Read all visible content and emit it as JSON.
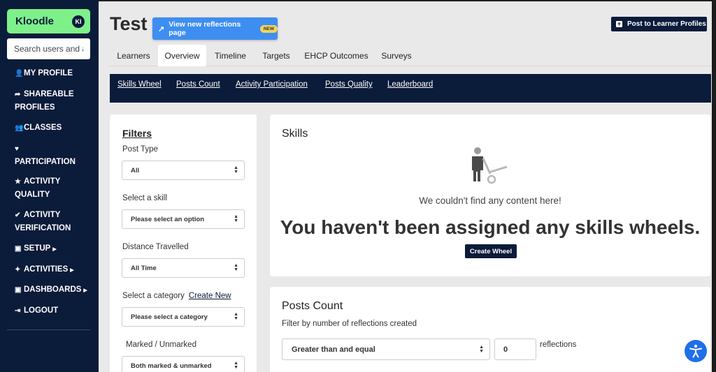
{
  "sidebar": {
    "brand": "Kloodle",
    "brand_badge": "KI",
    "search_placeholder": "Search users and a",
    "items": [
      {
        "label": "MY PROFILE",
        "icon": "user-icon",
        "glyph": "👤"
      },
      {
        "label": "SHAREABLE PROFILES",
        "icon": "share-icon",
        "glyph": "➦"
      },
      {
        "label": "CLASSES",
        "icon": "users-icon",
        "glyph": "👥"
      },
      {
        "label": "PARTICIPATION",
        "icon": "heart-icon",
        "glyph": "♥"
      },
      {
        "label": "ACTIVITY QUALITY",
        "icon": "star-icon",
        "glyph": "★"
      },
      {
        "label": "ACTIVITY VERIFICATION",
        "icon": "check-circle-icon",
        "glyph": "✔"
      },
      {
        "label": "SETUP",
        "icon": "setup-icon",
        "glyph": "▣"
      },
      {
        "label": "ACTIVITIES",
        "icon": "activities-icon",
        "glyph": "✦"
      },
      {
        "label": "DASHBOARDS",
        "icon": "dashboard-icon",
        "glyph": "▣"
      },
      {
        "label": "LOGOUT",
        "icon": "logout-icon",
        "glyph": "⇥"
      }
    ]
  },
  "header": {
    "title": "Test",
    "reflections_button": "View new reflections page",
    "new_badge": "NEW",
    "post_button": "Post to Learner Profiles"
  },
  "tabs": [
    "Learners",
    "Overview",
    "Timeline",
    "Targets",
    "EHCP Outcomes",
    "Surveys"
  ],
  "active_tab": "Overview",
  "subnav": [
    "Skills Wheel",
    "Posts Count",
    "Activity Participation",
    "Posts Quality",
    "Leaderboard"
  ],
  "filters": {
    "title": "Filters",
    "post_type_label": "Post Type",
    "post_type_value": "All",
    "skill_label": "Select a skill",
    "skill_value": "Please select an option",
    "distance_label": "Distance Travelled",
    "distance_value": "All Time",
    "category_label": "Select a category",
    "create_new": "Create New",
    "category_value": "Please select a category",
    "marked_label": "Marked / Unmarked",
    "marked_value": "Both marked & unmarked"
  },
  "skills": {
    "title": "Skills",
    "empty_message": "We couldn't find any content here!",
    "empty_headline": "You haven't been assigned any skills wheels.",
    "create_button": "Create Wheel"
  },
  "posts_count": {
    "title": "Posts Count",
    "subtitle": "Filter by number of reflections created",
    "comparator_value": "Greater than and equal",
    "count_value": "0",
    "suffix": "reflections"
  }
}
